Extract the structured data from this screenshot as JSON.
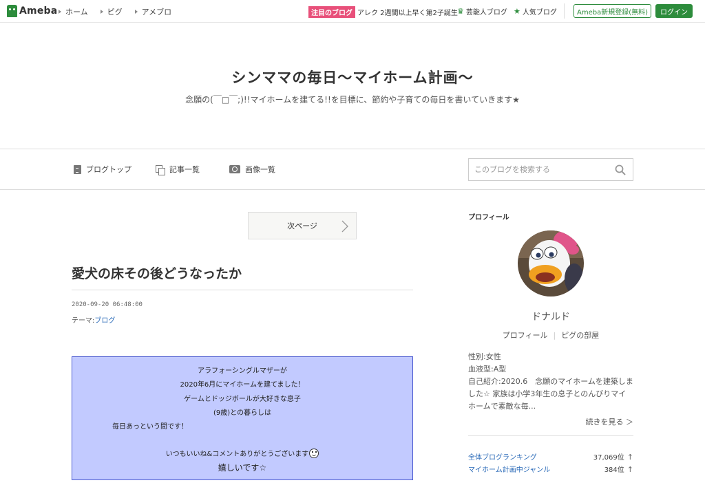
{
  "topbar": {
    "logo_text": "Ameba",
    "nav": [
      "ホーム",
      "ピグ",
      "アメブロ"
    ],
    "trend_badge": "注目のブログ",
    "trend_text": "アレク 2週間以上早く第2子誕生",
    "celeb_link": "芸能人ブログ",
    "popular_link": "人気ブログ",
    "register_label": "Ameba新規登録(無料)",
    "login_label": "ログイン",
    "accent_color": "#2d8c3c"
  },
  "header": {
    "title": "シンママの毎日～マイホーム計画～",
    "description": "念願の(￣□￣;)!!マイホームを建てる!!を目標に、節約や子育ての毎日を書いていきます★"
  },
  "menu": {
    "items": [
      "ブログトップ",
      "記事一覧",
      "画像一覧"
    ],
    "search_placeholder": "このブログを検索する"
  },
  "post": {
    "next_page_label": "次ページ",
    "title": "愛犬の床その後どうなったか",
    "date": "2020-09-20 06:48:00",
    "theme_label": "テーマ:",
    "theme_link": "ブログ",
    "intro_lines": [
      "アラフォーシングルマザーが",
      "2020年6月にマイホームを建てました！",
      "ゲームとドッジボールが大好きな息子",
      "(9歳)との暮らしは",
      "毎日あっという間です！",
      "いつもいいね&コメントありがとうございます",
      "嬉しいです☆"
    ],
    "intro_bg_color": "#c2caff"
  },
  "sidebar": {
    "heading": "プロフィール",
    "name": "ドナルド",
    "profile_link": "プロフィール",
    "pig_link": "ピグの部屋",
    "gender": "性別:女性",
    "blood": "血液型:A型",
    "intro": "自己紹介:2020.6　念願のマイホームを建築しました☆ 家族は小学3年生の息子とのんびりマイホームで素敵な毎...",
    "more_label": "続きを見る ＞",
    "rankings": [
      {
        "name": "全体ブログランキング",
        "value": "37,069位"
      },
      {
        "name": "マイホーム計画中ジャンル",
        "value": "384位"
      }
    ]
  }
}
